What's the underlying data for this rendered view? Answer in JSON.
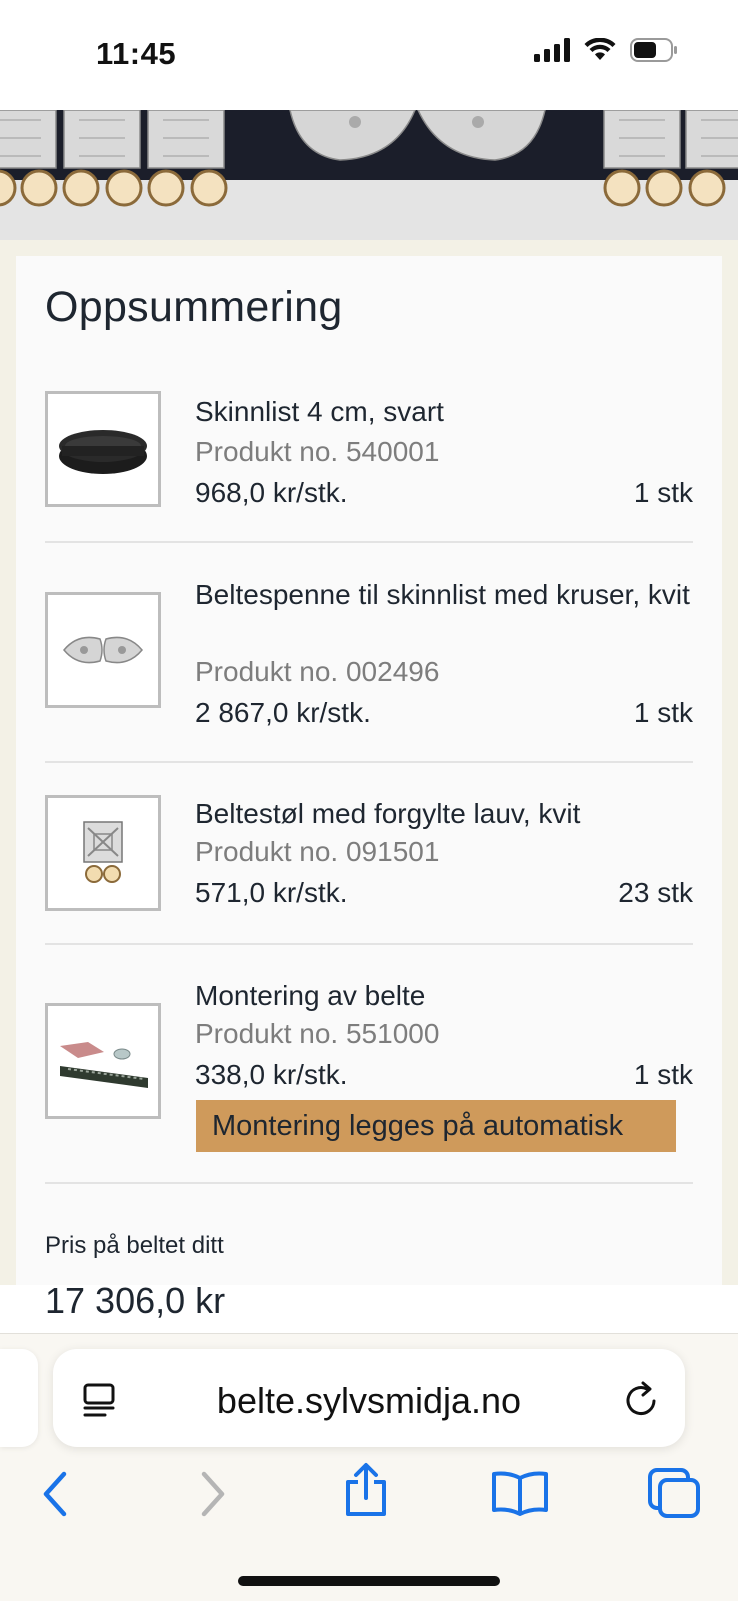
{
  "status_bar": {
    "time": "11:45"
  },
  "summary": {
    "title": "Oppsummering",
    "items": [
      {
        "name": "Skinnlist 4 cm, svart",
        "product_no": "Produkt no. 540001",
        "price": "968,0 kr/stk.",
        "qty": "1 stk",
        "thumb_icon": "black-leather-belt-icon"
      },
      {
        "name": "Beltespenne til skinnlist med kruser, kvit",
        "product_no": "Produkt no. 002496",
        "price": "2 867,0 kr/stk.",
        "qty": "1 stk",
        "thumb_icon": "silver-buckle-icon"
      },
      {
        "name": "Beltestøl med forgylte lauv, kvit",
        "product_no": "Produkt no. 091501",
        "price": "571,0 kr/stk.",
        "qty": "23 stk",
        "thumb_icon": "belt-plate-icon"
      },
      {
        "name": "Montering av belte",
        "product_no": "Produkt no. 551000",
        "price": "338,0 kr/stk.",
        "qty": "1 stk",
        "thumb_icon": "assembly-icon"
      }
    ],
    "auto_notice": "Montering legges på automatisk",
    "total_label": "Pris på beltet ditt",
    "total_value": "17 306,0 kr"
  },
  "browser": {
    "url": "belte.sylvsmidja.no",
    "accent": "#1a73e8"
  },
  "colors": {
    "badge": "#cf9a5b",
    "page_bg": "#f3f1e6",
    "card_bg": "#fafafa"
  }
}
